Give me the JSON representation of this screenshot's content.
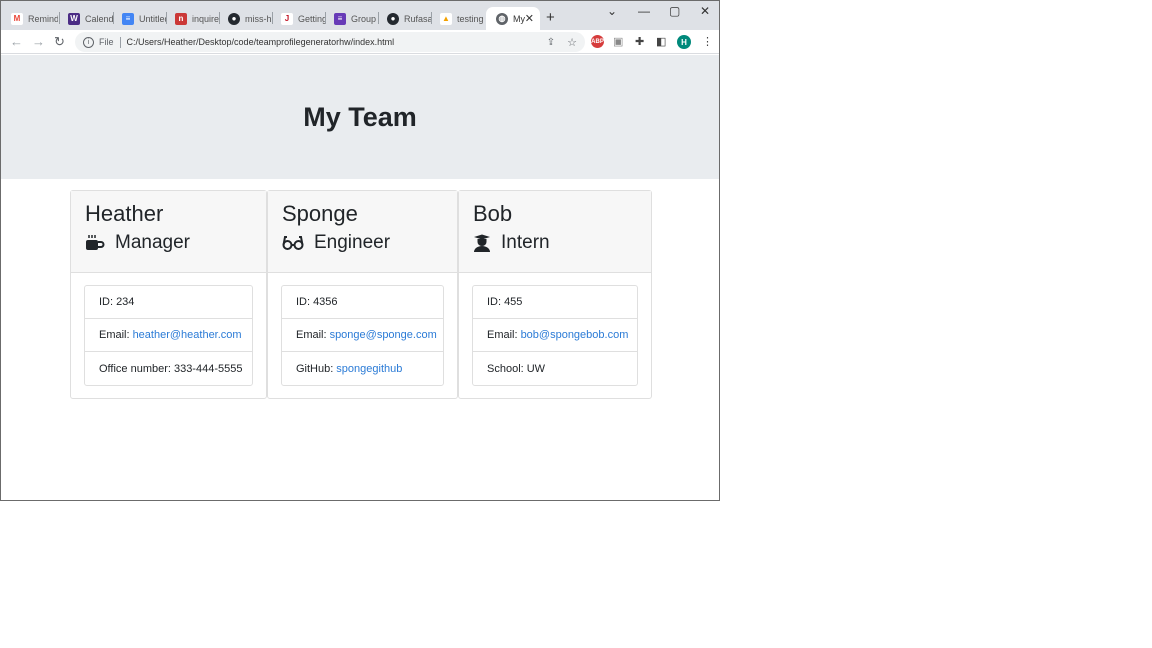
{
  "browser": {
    "tabs": [
      {
        "title": "Remind",
        "favicon": "gmail-icon",
        "color": "#ea4335",
        "glyph": "M"
      },
      {
        "title": "Calendar",
        "favicon": "w-icon",
        "color": "#4b2c85",
        "glyph": "W"
      },
      {
        "title": "Untitled",
        "favicon": "docs-icon",
        "color": "#4285f4",
        "glyph": "≡"
      },
      {
        "title": "inquirer",
        "favicon": "npm-icon",
        "color": "#cb3837",
        "glyph": "n"
      },
      {
        "title": "miss-h",
        "favicon": "github-icon",
        "color": "#24292f",
        "glyph": "●"
      },
      {
        "title": "Getting",
        "favicon": "jest-icon",
        "color": "#c21325",
        "glyph": "J"
      },
      {
        "title": "Group",
        "favicon": "list-icon",
        "color": "#673ab7",
        "glyph": "≡"
      },
      {
        "title": "Rufasa",
        "favicon": "github-icon",
        "color": "#24292f",
        "glyph": "●"
      },
      {
        "title": "testing",
        "favicon": "flask-icon",
        "color": "#f4a100",
        "glyph": "▲"
      },
      {
        "title": "My",
        "favicon": "globe-icon",
        "color": "#5f6368",
        "glyph": "◍",
        "active": true
      }
    ],
    "file_label": "File",
    "url": "C:/Users/Heather/Desktop/code/teamprofilegeneratorhw/index.html",
    "profile_initial": "H",
    "adblock_label": "ABP"
  },
  "page": {
    "title": "My Team",
    "members": [
      {
        "name": "Heather",
        "role": "Manager",
        "icon": "coffee-mug-icon",
        "rows": [
          {
            "label": "ID:",
            "value": "234",
            "link": false
          },
          {
            "label": "Email:",
            "value": "heather@heather.com",
            "link": true
          },
          {
            "label": "Office number:",
            "value": "333-444-5555",
            "link": false
          }
        ]
      },
      {
        "name": "Sponge",
        "role": "Engineer",
        "icon": "glasses-icon",
        "rows": [
          {
            "label": "ID:",
            "value": "4356",
            "link": false
          },
          {
            "label": "Email:",
            "value": "sponge@sponge.com",
            "link": true
          },
          {
            "label": "GitHub:",
            "value": "spongegithub",
            "link": true
          }
        ]
      },
      {
        "name": "Bob",
        "role": "Intern",
        "icon": "graduate-icon",
        "rows": [
          {
            "label": "ID:",
            "value": "455",
            "link": false
          },
          {
            "label": "Email:",
            "value": "bob@spongebob.com",
            "link": true
          },
          {
            "label": "School:",
            "value": "UW",
            "link": false
          }
        ]
      }
    ]
  }
}
